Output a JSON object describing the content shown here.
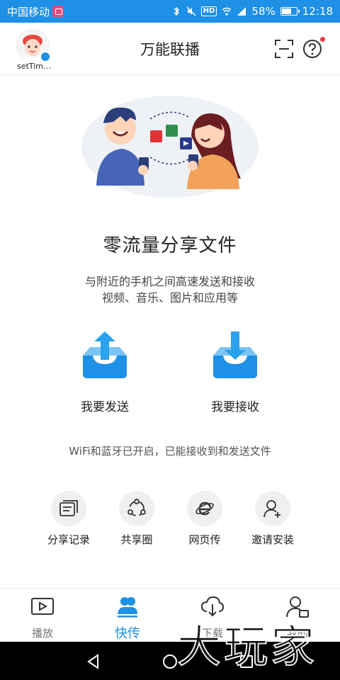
{
  "status_bar": {
    "carrier": "中国移动",
    "hd": "HD",
    "network": "4G",
    "battery": "58%",
    "time": "12:18"
  },
  "header": {
    "title": "万能联播",
    "user_name": "setTime...",
    "scan_icon": "scan-icon",
    "help_icon": "help-icon"
  },
  "hero": {
    "title": "零流量分享文件",
    "desc_line1": "与附近的手机之间高速发送和接收",
    "desc_line2": "视频、音乐、图片和应用等"
  },
  "actions": {
    "send_label": "我要发送",
    "receive_label": "我要接收"
  },
  "status_text": "WiFi和蓝牙已开启，已能接收到和发送文件",
  "tools": [
    {
      "label": "分享记录",
      "icon": "history-icon"
    },
    {
      "label": "共享圈",
      "icon": "share-circle-icon"
    },
    {
      "label": "网页传",
      "icon": "browser-icon"
    },
    {
      "label": "邀请安装",
      "icon": "invite-user-icon"
    }
  ],
  "tabs": [
    {
      "label": "播放",
      "icon": "play-icon",
      "active": false
    },
    {
      "label": "快传",
      "icon": "users-icon",
      "active": true
    },
    {
      "label": "下载",
      "icon": "cloud-download-icon",
      "active": false
    },
    {
      "label": "我的",
      "icon": "profile-icon",
      "active": false
    }
  ],
  "watermark": "大玩家",
  "colors": {
    "accent": "#1e90e6",
    "status_bar": "#1e90e6",
    "notification_dot": "#f0383f"
  }
}
